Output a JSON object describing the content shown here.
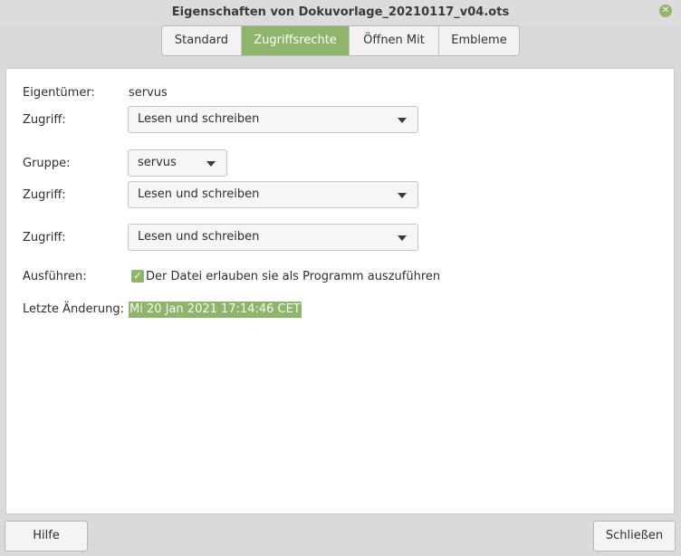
{
  "window": {
    "title": "Eigenschaften von Dokuvorlage_20210117_v04.ots",
    "close_icon": "close-icon"
  },
  "tabs": [
    {
      "label": "Standard",
      "active": false
    },
    {
      "label": "Zugriffsrechte",
      "active": true
    },
    {
      "label": "Öffnen Mit",
      "active": false
    },
    {
      "label": "Embleme",
      "active": false
    }
  ],
  "permissions": {
    "owner_label": "Eigentümer:",
    "owner_value": "servus",
    "owner_access_label": "Zugriff:",
    "owner_access_value": "Lesen und schreiben",
    "group_label": "Gruppe:",
    "group_value": "servus",
    "group_access_label": "Zugriff:",
    "group_access_value": "Lesen und schreiben",
    "other_access_label": "Zugriff:",
    "other_access_value": "Lesen und schreiben",
    "execute_label": "Ausführen:",
    "execute_checkbox_label": "Der Datei erlauben sie als Programm auszuführen",
    "execute_checked": true,
    "modified_label": "Letzte Änderung:",
    "modified_value": "Mi 20 Jan 2021 17:14:46 CET"
  },
  "footer": {
    "help_label": "Hilfe",
    "close_label": "Schließen"
  },
  "colors": {
    "accent": "#8fb56c",
    "window_bg": "#dadada",
    "panel_bg": "#ffffff"
  }
}
